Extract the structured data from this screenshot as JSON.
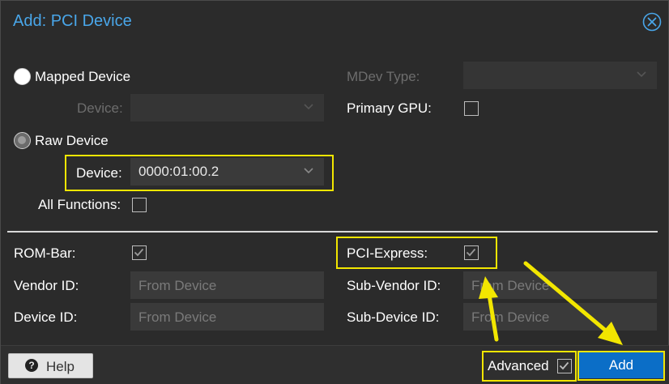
{
  "dialog": {
    "title": "Add: PCI Device"
  },
  "left": {
    "mapped_device_label": "Mapped Device",
    "device_label": "Device:",
    "raw_device_label": "Raw Device",
    "raw_device_label2": "Device:",
    "raw_device_value": "0000:01:00.2",
    "all_functions_label": "All Functions:"
  },
  "right": {
    "mdev_type_label": "MDev Type:",
    "primary_gpu_label": "Primary GPU:"
  },
  "advanced": {
    "rom_bar_label": "ROM-Bar:",
    "vendor_id_label": "Vendor ID:",
    "device_id_label": "Device ID:",
    "vendor_id_placeholder": "From Device",
    "device_id_placeholder": "From Device",
    "pci_express_label": "PCI-Express:",
    "sub_vendor_id_label": "Sub-Vendor ID:",
    "sub_device_id_label": "Sub-Device ID:",
    "sub_vendor_id_placeholder": "From Device",
    "sub_device_id_placeholder": "From Device"
  },
  "footer": {
    "help_label": "Help",
    "advanced_label": "Advanced",
    "add_label": "Add"
  },
  "state": {
    "mapped_device_selected": false,
    "raw_device_selected": true,
    "all_functions_checked": false,
    "primary_gpu_checked": false,
    "rom_bar_checked": true,
    "pci_express_checked": true,
    "advanced_checked": true
  },
  "colors": {
    "title": "#49a6e9",
    "highlight": "#f2e600",
    "add_button": "#0b6ec7",
    "background": "#2b2b2b"
  },
  "icons": {
    "close": "close-circle-icon",
    "help": "question-circle-icon",
    "dropdown": "chevron-down-icon",
    "annotation": "arrow-annotation"
  }
}
